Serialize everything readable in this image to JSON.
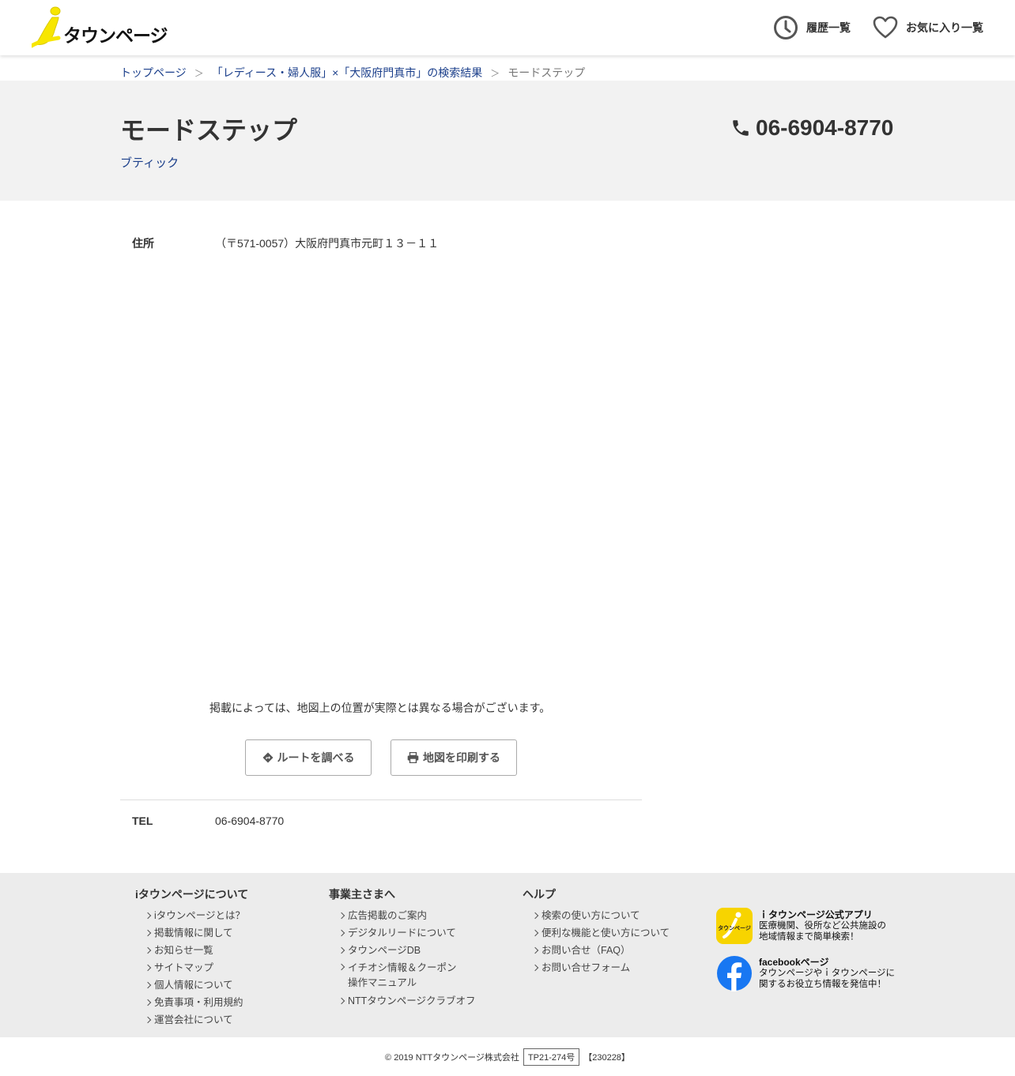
{
  "header": {
    "logo_text": "タウンページ",
    "history_label": "履歴一覧",
    "favorites_label": "お気に入り一覧"
  },
  "breadcrumb": {
    "home": "トップページ",
    "sep": "＞",
    "search_result": "「レディース・婦人服」×「大阪府門真市」の検索結果",
    "current": "モードステップ"
  },
  "shop": {
    "name": "モードステップ",
    "category": "ブティック",
    "phone": "06-6904-8770"
  },
  "details": {
    "address_label": "住所",
    "address_value": "（〒571-0057）大阪府門真市元町１３－１１",
    "map_note": "掲載によっては、地図上の位置が実際とは異なる場合がございます。",
    "route_button": "ルートを調べる",
    "print_button": "地図を印刷する",
    "tel_label": "TEL",
    "tel_value": "06-6904-8770"
  },
  "footer": {
    "about": {
      "title": "iタウンページについて",
      "items": [
        "iタウンページとは？",
        "掲載情報に関して",
        "お知らせ一覧",
        "サイトマップ",
        "個人情報について",
        "免責事項・利用規約",
        "運営会社について"
      ]
    },
    "business": {
      "title": "事業主さまへ",
      "items": [
        "広告掲載のご案内",
        "デジタルリードについて",
        "タウンページDB",
        "イチオシ情報＆クーポン",
        "操作マニュアル",
        "NTTタウンページクラブオフ"
      ]
    },
    "help": {
      "title": "ヘルプ",
      "items": [
        "検索の使い方について",
        "便利な機能と使い方について",
        "お問い合せ（FAQ）",
        "お問い合せフォーム"
      ]
    },
    "app_promo": {
      "title": "ｉタウンページ公式アプリ",
      "line1": "医療機関、役所など公共施設の",
      "line2": "地域情報まで簡単検索！",
      "icon_text": "タウンページ"
    },
    "fb_promo": {
      "title": "facebookページ",
      "line1": "タウンページやｉタウンページに",
      "line2": "関するお役立ち情報を発信中！"
    }
  },
  "copyright": {
    "text": "© 2019 NTTタウンページ株式会社",
    "registration": "TP21-274号",
    "code": "【230228】"
  },
  "colors": {
    "link": "#1b3f8b",
    "logo_yellow": "#f7e600",
    "footer_bg": "#ececec",
    "band_bg": "#f2f2f2",
    "facebook": "#1877f2"
  }
}
